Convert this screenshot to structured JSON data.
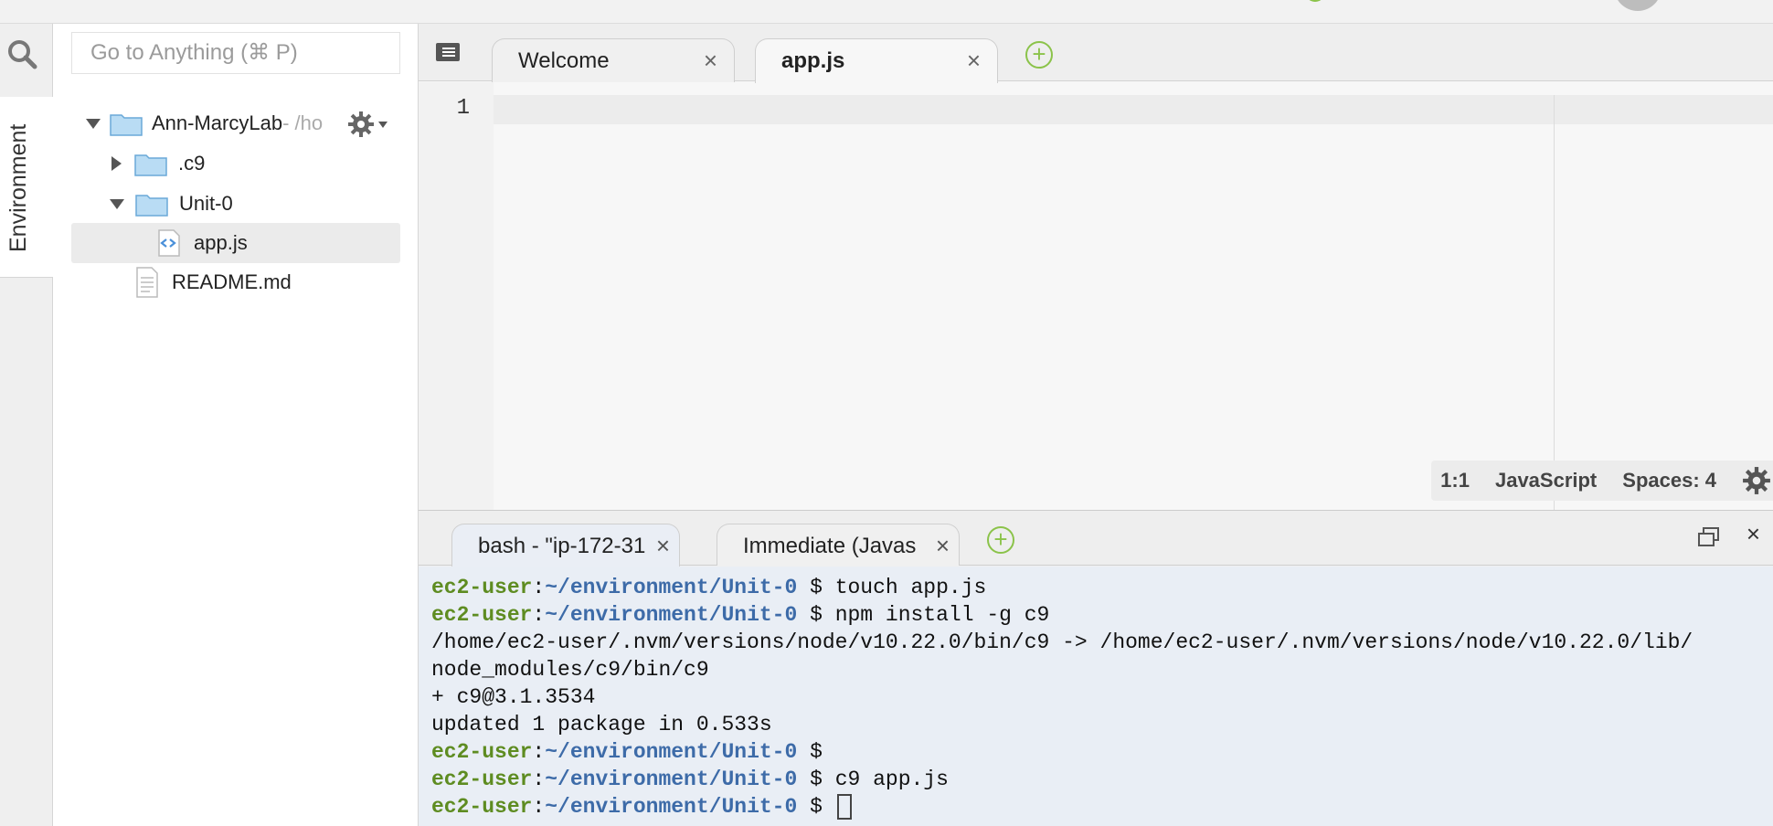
{
  "sidebar_rail": {
    "environment_tab_label": "Environment"
  },
  "file_tree": {
    "goto_placeholder": "Go to Anything (⌘ P)",
    "root": {
      "name": "Ann-MarcyLab",
      "suffix": " - /ho"
    },
    "items": [
      {
        "name": ".c9",
        "type": "folder",
        "expanded": false
      },
      {
        "name": "Unit-0",
        "type": "folder",
        "expanded": true
      },
      {
        "name": "app.js",
        "type": "file-js",
        "selected": true
      },
      {
        "name": "README.md",
        "type": "file-text"
      }
    ]
  },
  "editor": {
    "tabs": [
      {
        "label": "Welcome",
        "active": false
      },
      {
        "label": "app.js",
        "active": true
      }
    ],
    "line_numbers": [
      "1"
    ],
    "status": {
      "cursor": "1:1",
      "language": "JavaScript",
      "indent": "Spaces: 4"
    }
  },
  "terminal_panel": {
    "tabs": [
      {
        "label": "bash - \"ip-172-31",
        "active": true
      },
      {
        "label": "Immediate (Javas",
        "active": false
      }
    ],
    "prompt_user": "ec2-user",
    "prompt_sep": ":",
    "prompt_path": "~/environment/Unit-0",
    "prompt_symbol": " $",
    "lines": [
      {
        "kind": "prompt",
        "cmd": " touch app.js"
      },
      {
        "kind": "prompt",
        "cmd": " npm install -g c9"
      },
      {
        "kind": "output",
        "text": "/home/ec2-user/.nvm/versions/node/v10.22.0/bin/c9 -> /home/ec2-user/.nvm/versions/node/v10.22.0/lib/"
      },
      {
        "kind": "output",
        "text": "node_modules/c9/bin/c9"
      },
      {
        "kind": "output",
        "text": "+ c9@3.1.3534"
      },
      {
        "kind": "output",
        "text": "updated 1 package in 0.533s"
      },
      {
        "kind": "prompt",
        "cmd": ""
      },
      {
        "kind": "prompt",
        "cmd": " c9 app.js"
      },
      {
        "kind": "prompt",
        "cmd": " ",
        "cursor": true
      }
    ]
  },
  "colors": {
    "prompt_user": "#5e8c21",
    "prompt_path": "#3d6ba8",
    "accent_add": "#8bc34a",
    "terminal_bg": "#e9eef5"
  }
}
